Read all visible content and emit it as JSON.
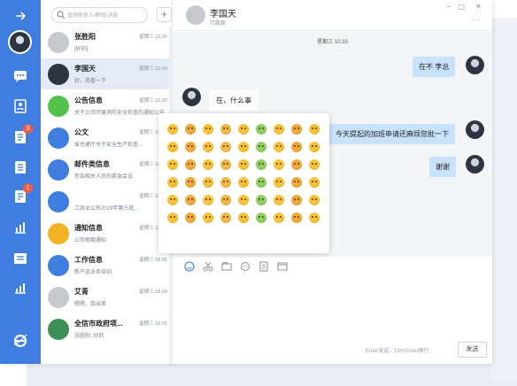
{
  "header": {
    "contact_name": "李国天",
    "contact_dept": "行政部",
    "more_label": "···"
  },
  "search": {
    "placeholder": "查询联系人/群组/消息"
  },
  "add_label": "+",
  "rail": {
    "badge_1": "3",
    "badge_2": "1"
  },
  "contacts": [
    {
      "name": "张胜阳",
      "time": "星期三 10:25",
      "preview": "[好的]",
      "avatar": "gray"
    },
    {
      "name": "李国天",
      "time": "星期三 10:24",
      "preview": "好，我看一下",
      "avatar": "photo"
    },
    {
      "name": "公告信息",
      "time": "星期三 10:20",
      "preview": "关于公司开展消防安全检查的通知公告",
      "avatar": "green"
    },
    {
      "name": "公文",
      "time": "星期三 10:19",
      "preview": "省住建厅关于安全生产检查...",
      "avatar": "blue"
    },
    {
      "name": "邮件类信息",
      "time": "星期三 10:18",
      "preview": "参加相关人员的紧急会议",
      "avatar": "blue"
    },
    {
      "name": "",
      "time": "星期三 10:18",
      "preview": "工商业公布2019年第三批...",
      "avatar": "blue"
    },
    {
      "name": "通知信息",
      "time": "星期三 10:18",
      "preview": "公司假期通知",
      "avatar": "yellow"
    },
    {
      "name": "工作信息",
      "time": "星期三 08:55",
      "preview": "新产品业务培训",
      "avatar": "blue"
    },
    {
      "name": "艾青",
      "time": "星期三 18:04",
      "preview": "嗯嗯，我出差",
      "avatar": "gray"
    },
    {
      "name": "全信市政府项...",
      "time": "星期三 10:25",
      "preview": "张胜阳: 好的",
      "avatar": "pic"
    }
  ],
  "messages": {
    "timestamp": "星期三 10:33",
    "m1": "在不 李总",
    "m2": "在，什么事",
    "m3": "今天提起的加班申请还麻烦您批一下",
    "m4": "谢谢"
  },
  "emoji_count": 54,
  "input": {
    "send_hint": "Enter发送，Ctrl+Enter换行",
    "send_label": "发送"
  }
}
